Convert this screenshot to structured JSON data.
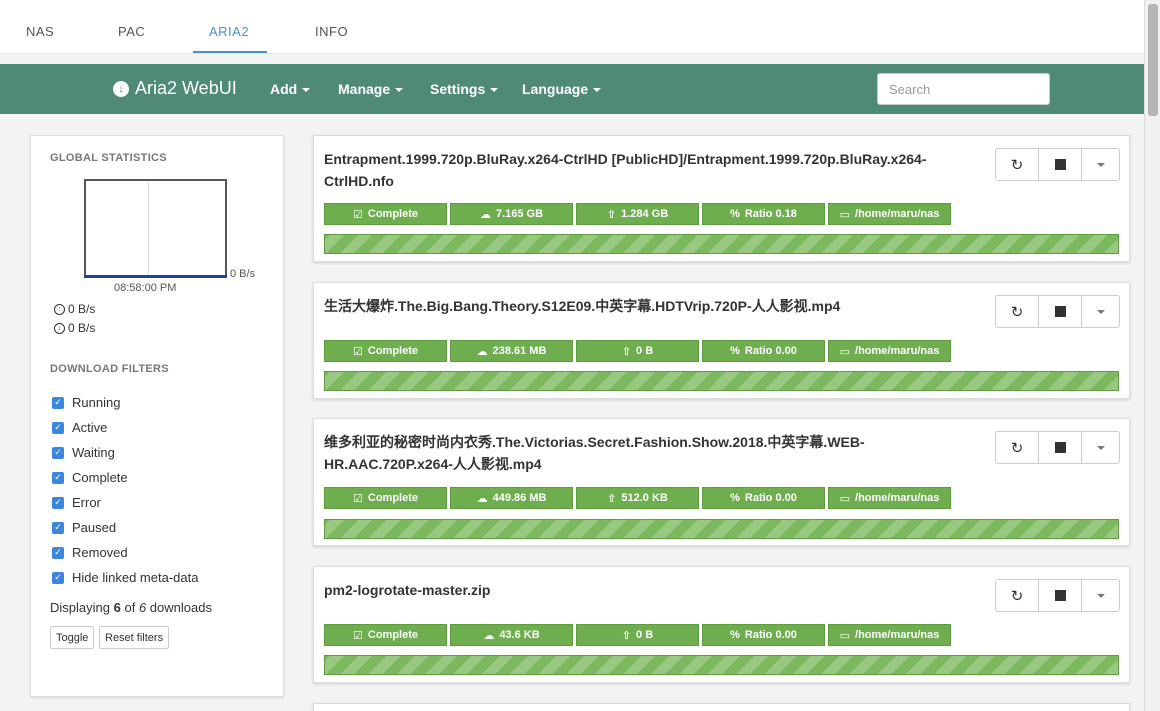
{
  "tabs": [
    {
      "label": "NAS"
    },
    {
      "label": "PAC"
    },
    {
      "label": "ARIA2"
    },
    {
      "label": "INFO"
    }
  ],
  "navbar": {
    "brand": "Aria2 WebUI",
    "menu": [
      {
        "label": "Add"
      },
      {
        "label": "Manage"
      },
      {
        "label": "Settings"
      },
      {
        "label": "Language"
      }
    ],
    "search_placeholder": "Search"
  },
  "sidebar": {
    "global_stats_title": "GLOBAL STATISTICS",
    "graph_y_label": "0 B/s",
    "graph_time": "08:58:00 PM",
    "upload_speed": "0 B/s",
    "download_speed": "0 B/s",
    "filters_title": "DOWNLOAD FILTERS",
    "filters": [
      {
        "label": "Running",
        "checked": true
      },
      {
        "label": "Active",
        "checked": true
      },
      {
        "label": "Waiting",
        "checked": true
      },
      {
        "label": "Complete",
        "checked": true
      },
      {
        "label": "Error",
        "checked": true
      },
      {
        "label": "Paused",
        "checked": true
      },
      {
        "label": "Removed",
        "checked": true
      },
      {
        "label": "Hide linked meta-data",
        "checked": true
      }
    ],
    "displaying_prefix": "Displaying",
    "displaying_count": "6",
    "displaying_of": "of",
    "displaying_total": "6",
    "displaying_suffix": "downloads",
    "toggle_label": "Toggle",
    "reset_label": "Reset filters"
  },
  "downloads": [
    {
      "title": "Entrapment.1999.720p.BluRay.x264-CtrlHD [PublicHD]/Entrapment.1999.720p.BluRay.x264-CtrlHD.nfo",
      "status": "Complete",
      "size": "7.165 GB",
      "uploaded": "1.284 GB",
      "ratio": "Ratio 0.18",
      "dir": "/home/maru/nas",
      "progress": 100
    },
    {
      "title": "生活大爆炸.The.Big.Bang.Theory.S12E09.中英字幕.HDTVrip.720P-人人影视.mp4",
      "status": "Complete",
      "size": "238.61 MB",
      "uploaded": "0 B",
      "ratio": "Ratio 0.00",
      "dir": "/home/maru/nas",
      "progress": 100
    },
    {
      "title": "维多利亚的秘密时尚内衣秀.The.Victorias.Secret.Fashion.Show.2018.中英字幕.WEB-HR.AAC.720P.x264-人人影视.mp4",
      "status": "Complete",
      "size": "449.86 MB",
      "uploaded": "512.0 KB",
      "ratio": "Ratio 0.00",
      "dir": "/home/maru/nas",
      "progress": 100
    },
    {
      "title": "pm2-logrotate-master.zip",
      "status": "Complete",
      "size": "43.6 KB",
      "uploaded": "0 B",
      "ratio": "Ratio 0.00",
      "dir": "/home/maru/nas",
      "progress": 100
    }
  ],
  "colors": {
    "navbar": "#4f8a77",
    "active_tab": "#4a90d9",
    "badge": "#6fae4e",
    "checkbox": "#3b86e0"
  },
  "icons": {
    "brand": "download-circle-icon",
    "restart": "refresh-icon",
    "stop": "stop-icon",
    "status": "check-icon",
    "size": "cloud-download-icon",
    "upload": "upload-icon",
    "ratio": "percent-icon",
    "dir": "folder-icon"
  }
}
